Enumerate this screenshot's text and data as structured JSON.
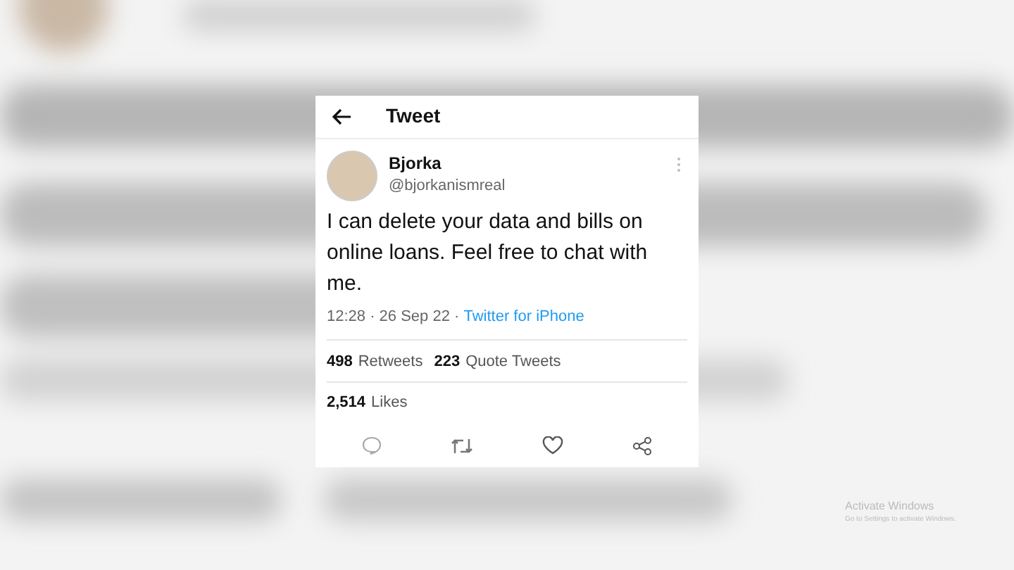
{
  "header": {
    "title": "Tweet"
  },
  "tweet": {
    "name": "Bjorka",
    "handle": "@bjorkanismreal",
    "text": "I can delete your data and bills on online loans. Feel free to chat with me.",
    "time": "12:28 · 26 Sep 22 · ",
    "source": "Twitter for iPhone"
  },
  "stats": [
    {
      "count": "498",
      "label": "Retweets"
    },
    {
      "count": "223",
      "label": "Quote Tweets"
    }
  ],
  "likes": {
    "count": "2,514",
    "label": "Likes"
  },
  "overlay": {
    "title": "Activate Windows",
    "subtitle": "Go to Settings to activate Windows."
  }
}
